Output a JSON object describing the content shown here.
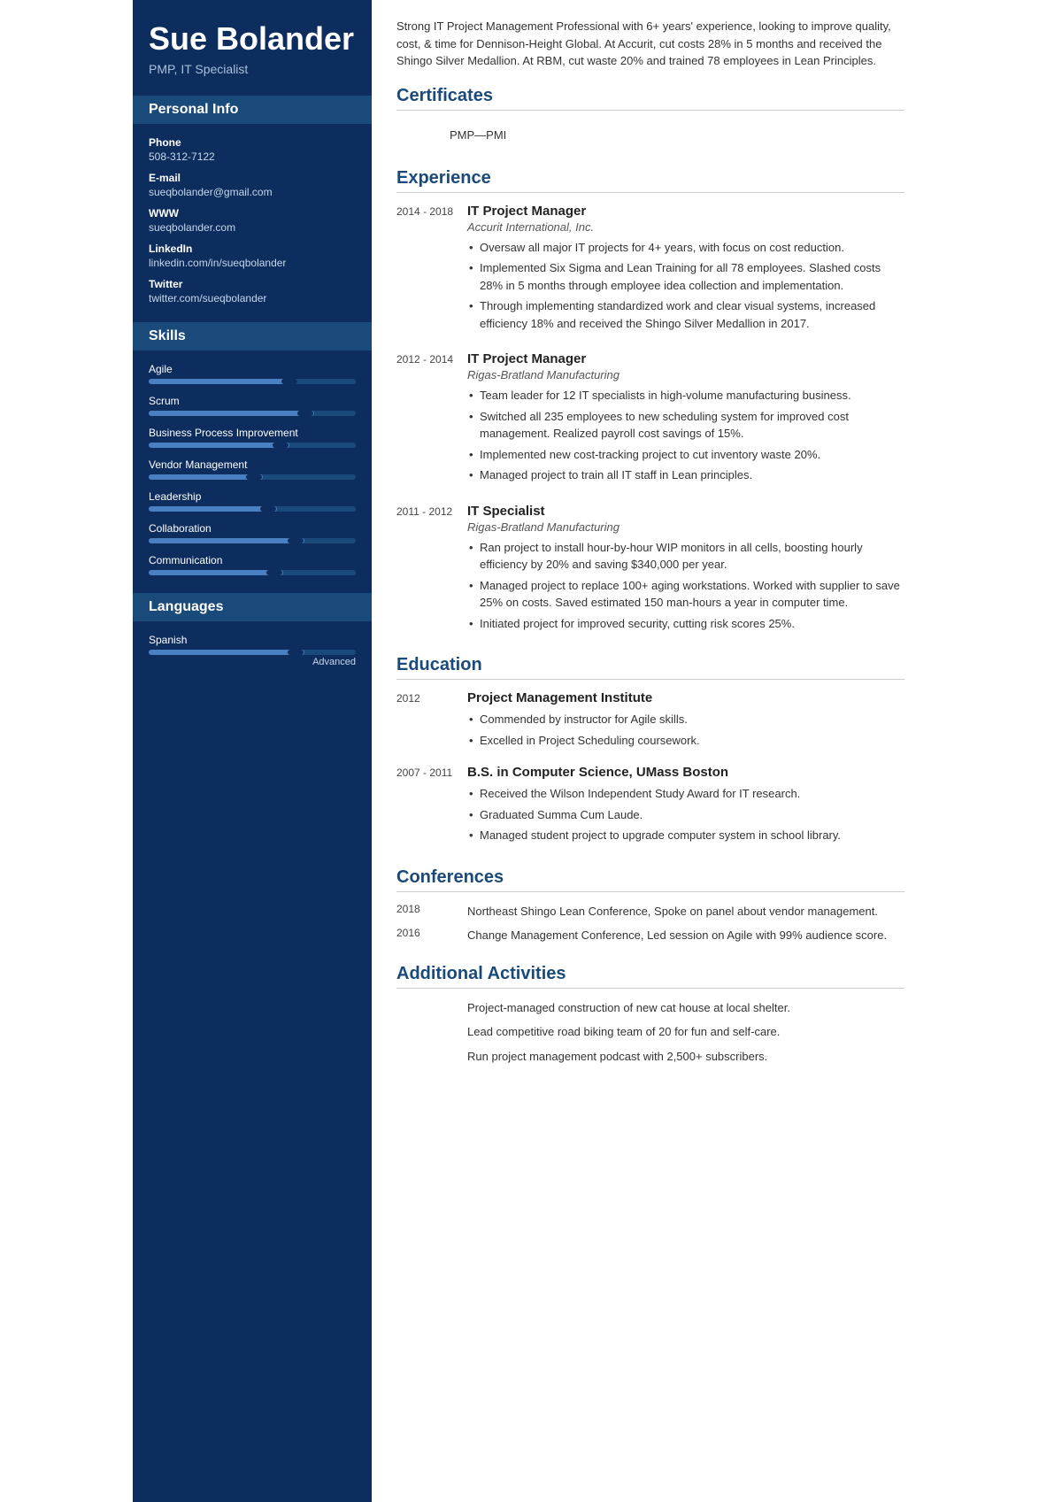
{
  "sidebar": {
    "name": "Sue Bolander",
    "title": "PMP, IT Specialist",
    "personal_info_section": "Personal Info",
    "personal_info": [
      {
        "label": "Phone",
        "value": "508-312-7122"
      },
      {
        "label": "E-mail",
        "value": "sueqbolander@gmail.com"
      },
      {
        "label": "WWW",
        "value": "sueqbolander.com"
      },
      {
        "label": "LinkedIn",
        "value": "linkedin.com/in/sueqbolander"
      },
      {
        "label": "Twitter",
        "value": "twitter.com/sueqbolander"
      }
    ],
    "skills_section": "Skills",
    "skills": [
      {
        "name": "Agile",
        "percent": 72
      },
      {
        "name": "Scrum",
        "percent": 80
      },
      {
        "name": "Business Process Improvement",
        "percent": 68
      },
      {
        "name": "Vendor Management",
        "percent": 55
      },
      {
        "name": "Leadership",
        "percent": 62
      },
      {
        "name": "Collaboration",
        "percent": 75
      },
      {
        "name": "Communication",
        "percent": 65
      }
    ],
    "languages_section": "Languages",
    "languages": [
      {
        "name": "Spanish",
        "percent": 75,
        "level": "Advanced"
      }
    ]
  },
  "main": {
    "summary": "Strong IT Project Management Professional with 6+ years' experience, looking to improve quality, cost, & time for Dennison-Height Global. At Accurit, cut costs 28% in 5 months and received the Shingo Silver Medallion. At RBM, cut waste 20% and trained 78 employees in Lean Principles.",
    "sections": {
      "certificates": {
        "title": "Certificates",
        "entries": [
          {
            "text": "PMP—PMI"
          }
        ]
      },
      "experience": {
        "title": "Experience",
        "entries": [
          {
            "dates": "2014 - 2018",
            "title": "IT Project Manager",
            "company": "Accurit International, Inc.",
            "bullets": [
              "Oversaw all major IT projects for 4+ years, with focus on cost reduction.",
              "Implemented Six Sigma and Lean Training for all 78 employees. Slashed costs 28% in 5 months through employee idea collection and implementation.",
              "Through implementing standardized work and clear visual systems, increased efficiency 18% and received the Shingo Silver Medallion in 2017."
            ]
          },
          {
            "dates": "2012 - 2014",
            "title": "IT Project Manager",
            "company": "Rigas-Bratland Manufacturing",
            "bullets": [
              "Team leader for 12 IT specialists in high-volume manufacturing business.",
              "Switched all 235 employees to new scheduling system for improved cost management. Realized payroll cost savings of 15%.",
              "Implemented new cost-tracking project to cut inventory waste 20%.",
              "Managed project to train all IT staff in Lean principles."
            ]
          },
          {
            "dates": "2011 - 2012",
            "title": "IT Specialist",
            "company": "Rigas-Bratland Manufacturing",
            "bullets": [
              "Ran project to install hour-by-hour WIP monitors in all cells, boosting hourly efficiency by 20% and saving $340,000 per year.",
              "Managed project to replace 100+ aging workstations. Worked with supplier to save 25% on costs. Saved estimated 150 man-hours a year in computer time.",
              "Initiated project for improved security, cutting risk scores 25%."
            ]
          }
        ]
      },
      "education": {
        "title": "Education",
        "entries": [
          {
            "year": "2012",
            "institution": "Project Management Institute",
            "bullets": [
              "Commended by instructor for Agile skills.",
              "Excelled in Project Scheduling coursework."
            ]
          },
          {
            "year": "2007 - 2011",
            "institution": "B.S. in Computer Science, UMass Boston",
            "bullets": [
              "Received the Wilson Independent Study Award for IT research.",
              "Graduated Summa Cum Laude.",
              "Managed student project to upgrade computer system in school library."
            ]
          }
        ]
      },
      "conferences": {
        "title": "Conferences",
        "entries": [
          {
            "year": "2018",
            "desc": "Northeast Shingo Lean Conference, Spoke on panel about vendor management."
          },
          {
            "year": "2016",
            "desc": "Change Management Conference, Led session on Agile with 99% audience score."
          }
        ]
      },
      "additional": {
        "title": "Additional Activities",
        "entries": [
          "Project-managed construction of new cat house at local shelter.",
          "Lead competitive road biking team of 20 for fun and self-care.",
          "Run project management podcast with 2,500+ subscribers."
        ]
      }
    }
  }
}
